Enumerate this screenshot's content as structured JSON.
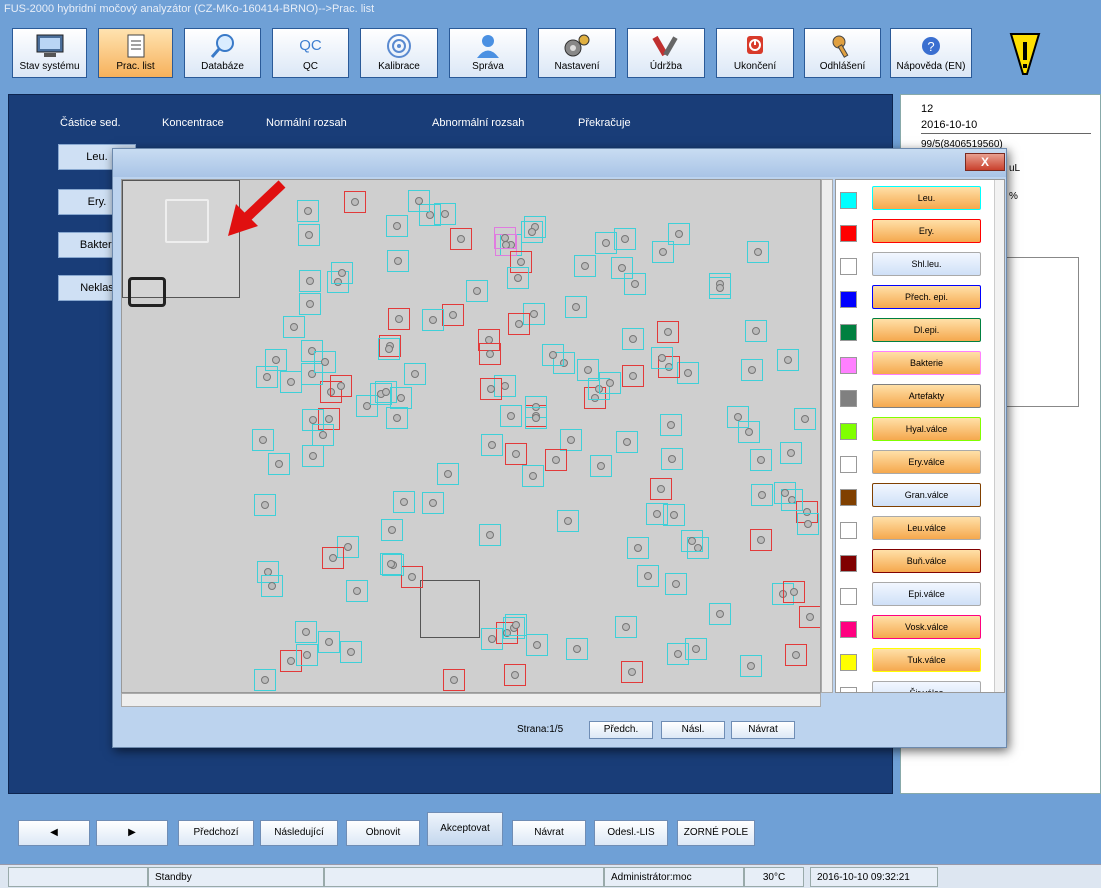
{
  "window": {
    "title": "FUS-2000 hybridní močový analyzátor (CZ-MKo-160414-BRNO)-->Prac. list"
  },
  "toolbar": {
    "items": [
      {
        "label": "Stav systému",
        "icon": "monitor-icon"
      },
      {
        "label": "Prac. list",
        "icon": "worklist-icon"
      },
      {
        "label": "Databáze",
        "icon": "magnifier-icon"
      },
      {
        "label": "QC",
        "icon": "qc-icon"
      },
      {
        "label": "Kalibrace",
        "icon": "target-icon"
      },
      {
        "label": "Správa",
        "icon": "user-icon"
      },
      {
        "label": "Nastavení",
        "icon": "gears-icon"
      },
      {
        "label": "Údržba",
        "icon": "tools-icon"
      },
      {
        "label": "Ukončení",
        "icon": "power-icon"
      },
      {
        "label": "Odhlášení",
        "icon": "key-icon"
      },
      {
        "label": "Nápověda (EN)",
        "icon": "help-icon"
      }
    ],
    "qc_icon_text": "QC"
  },
  "main": {
    "headers": [
      "Částice sed.",
      "Koncentrace",
      "Normální rozsah",
      "Abnormální rozsah",
      "Překračuje"
    ],
    "side_buttons": [
      "Leu.",
      "Ery.",
      "Bakteri",
      "Neklas"
    ]
  },
  "rightpanel": {
    "number": "12",
    "date": "2016-10-10",
    "sample": "99/5(8406519560)",
    "unit_fragment": "uL",
    "pct": "%"
  },
  "dialog": {
    "close": "X",
    "page_label": "Strana:1/5",
    "prev": "Předch.",
    "next": "Násl.",
    "back": "Návrat"
  },
  "legend": [
    {
      "label": "Leu.",
      "color": "#00ffff",
      "style": "or"
    },
    {
      "label": "Ery.",
      "color": "#ff0000",
      "style": "or"
    },
    {
      "label": "Shl.leu.",
      "color": "#ffffff",
      "style": "bl"
    },
    {
      "label": "Přech. epi.",
      "color": "#0000ff",
      "style": "or"
    },
    {
      "label": "Dl.epi.",
      "color": "#008040",
      "style": "or"
    },
    {
      "label": "Bakterie",
      "color": "#ff80ff",
      "style": "or"
    },
    {
      "label": "Artefakty",
      "color": "#808080",
      "style": "or"
    },
    {
      "label": "Hyal.válce",
      "color": "#80ff00",
      "style": "or"
    },
    {
      "label": "Ery.válce",
      "color": "#ffffff",
      "style": "or"
    },
    {
      "label": "Gran.válce",
      "color": "#804000",
      "style": "bl"
    },
    {
      "label": "Leu.válce",
      "color": "#ffffff",
      "style": "or"
    },
    {
      "label": "Buň.válce",
      "color": "#800000",
      "style": "or"
    },
    {
      "label": "Epi.válce",
      "color": "#ffffff",
      "style": "bl"
    },
    {
      "label": "Vosk.válce",
      "color": "#ff0080",
      "style": "or"
    },
    {
      "label": "Tuk.válce",
      "color": "#ffff00",
      "style": "or"
    },
    {
      "label": "Šir.válce",
      "color": "#ffffff",
      "style": "bl"
    }
  ],
  "bottom": {
    "prev_arrow": "◀",
    "next_arrow": "▶",
    "buttons": [
      "Předchozí",
      "Následující",
      "Obnovit",
      "Akceptovat",
      "Návrat",
      "Odesl.-LIS",
      "ZORNÉ POLE"
    ]
  },
  "status": {
    "state": "Standby",
    "user": "Administrátor:moc",
    "temp": "30°C",
    "datetime": "2016-10-10 09:32:21"
  }
}
